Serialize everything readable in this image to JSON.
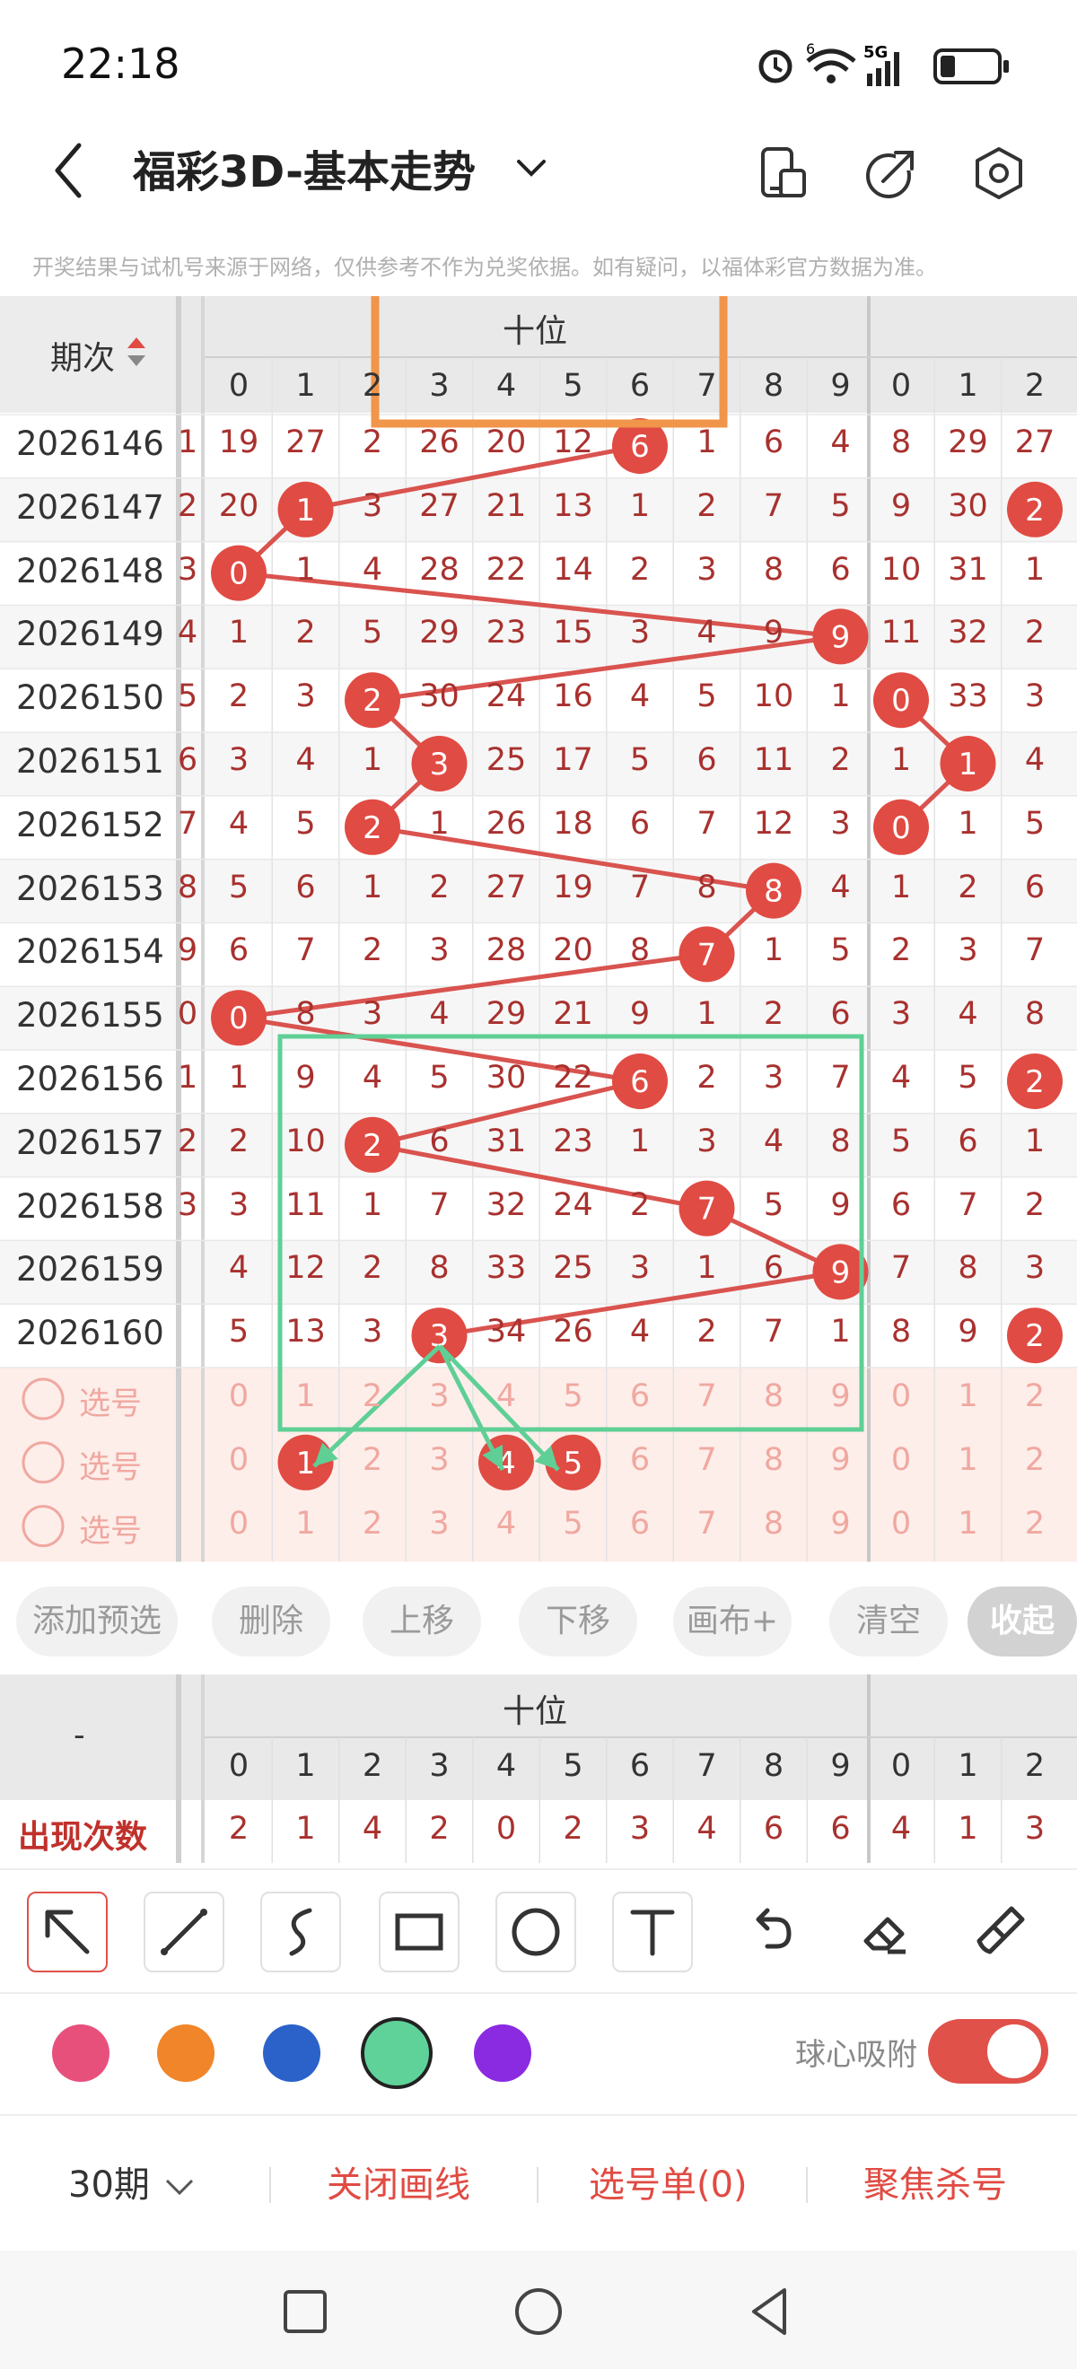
{
  "status_bar": {
    "time": "22:18",
    "network": "5G",
    "wifi_badge": "6"
  },
  "header": {
    "title": "福彩3D-基本走势"
  },
  "notice": "开奖结果与试机号来源于网络，仅供参考不作为兑奖依据。如有疑问，以福体彩官方数据为准。",
  "table": {
    "period_header": "期次",
    "group_title": "十位",
    "digits_main": [
      "0",
      "1",
      "2",
      "3",
      "4",
      "5",
      "6",
      "7",
      "8",
      "9"
    ],
    "digits_next": [
      "0",
      "1",
      "2"
    ],
    "rows": [
      {
        "period": "2026146",
        "edge": "1",
        "cells": [
          "19",
          "27",
          "2",
          "26",
          "20",
          "12",
          "6",
          "1",
          "6",
          "4"
        ],
        "hit": 6,
        "next": [
          "8",
          "29",
          "27"
        ],
        "next_hit": -1
      },
      {
        "period": "2026147",
        "edge": "2",
        "cells": [
          "20",
          "1",
          "3",
          "27",
          "21",
          "13",
          "1",
          "2",
          "7",
          "5"
        ],
        "hit": 1,
        "next": [
          "9",
          "30",
          "2"
        ],
        "next_hit": 2
      },
      {
        "period": "2026148",
        "edge": "3",
        "cells": [
          "0",
          "1",
          "4",
          "28",
          "22",
          "14",
          "2",
          "3",
          "8",
          "6"
        ],
        "hit": 0,
        "next": [
          "10",
          "31",
          "1"
        ],
        "next_hit": -1
      },
      {
        "period": "2026149",
        "edge": "4",
        "cells": [
          "1",
          "2",
          "5",
          "29",
          "23",
          "15",
          "3",
          "4",
          "9",
          "9"
        ],
        "hit": 9,
        "next": [
          "11",
          "32",
          "2"
        ],
        "next_hit": -1
      },
      {
        "period": "2026150",
        "edge": "5",
        "cells": [
          "2",
          "3",
          "2",
          "30",
          "24",
          "16",
          "4",
          "5",
          "10",
          "1"
        ],
        "hit": 2,
        "next": [
          "0",
          "33",
          "3"
        ],
        "next_hit": 0
      },
      {
        "period": "2026151",
        "edge": "6",
        "cells": [
          "3",
          "4",
          "1",
          "3",
          "25",
          "17",
          "5",
          "6",
          "11",
          "2"
        ],
        "hit": 3,
        "next": [
          "1",
          "1",
          "4"
        ],
        "next_hit": 1
      },
      {
        "period": "2026152",
        "edge": "7",
        "cells": [
          "4",
          "5",
          "2",
          "1",
          "26",
          "18",
          "6",
          "7",
          "12",
          "3"
        ],
        "hit": 2,
        "next": [
          "0",
          "1",
          "5"
        ],
        "next_hit": 0
      },
      {
        "period": "2026153",
        "edge": "8",
        "cells": [
          "5",
          "6",
          "1",
          "2",
          "27",
          "19",
          "7",
          "8",
          "8",
          "4"
        ],
        "hit": 8,
        "next": [
          "1",
          "2",
          "6"
        ],
        "next_hit": -1
      },
      {
        "period": "2026154",
        "edge": "9",
        "cells": [
          "6",
          "7",
          "2",
          "3",
          "28",
          "20",
          "8",
          "7",
          "1",
          "5"
        ],
        "hit": 7,
        "next": [
          "2",
          "3",
          "7"
        ],
        "next_hit": -1
      },
      {
        "period": "2026155",
        "edge": "0",
        "cells": [
          "0",
          "8",
          "3",
          "4",
          "29",
          "21",
          "9",
          "1",
          "2",
          "6"
        ],
        "hit": 0,
        "next": [
          "3",
          "4",
          "8"
        ],
        "next_hit": -1
      },
      {
        "period": "2026156",
        "edge": "1",
        "cells": [
          "1",
          "9",
          "4",
          "5",
          "30",
          "22",
          "6",
          "2",
          "3",
          "7"
        ],
        "hit": 6,
        "next": [
          "4",
          "5",
          "2"
        ],
        "next_hit": 2
      },
      {
        "period": "2026157",
        "edge": "2",
        "cells": [
          "2",
          "10",
          "2",
          "6",
          "31",
          "23",
          "1",
          "3",
          "4",
          "8"
        ],
        "hit": 2,
        "next": [
          "5",
          "6",
          "1"
        ],
        "next_hit": -1
      },
      {
        "period": "2026158",
        "edge": "3",
        "cells": [
          "3",
          "11",
          "1",
          "7",
          "32",
          "24",
          "2",
          "7",
          "5",
          "9"
        ],
        "hit": 7,
        "next": [
          "6",
          "7",
          "2"
        ],
        "next_hit": -1
      },
      {
        "period": "2026159",
        "edge": "",
        "cells": [
          "4",
          "12",
          "2",
          "8",
          "33",
          "25",
          "3",
          "1",
          "6",
          "9"
        ],
        "hit": 9,
        "next": [
          "7",
          "8",
          "3"
        ],
        "next_hit": -1
      },
      {
        "period": "2026160",
        "edge": "",
        "cells": [
          "5",
          "13",
          "3",
          "3",
          "34",
          "26",
          "4",
          "2",
          "7",
          "1"
        ],
        "hit": 3,
        "next": [
          "8",
          "9",
          "2"
        ],
        "next_hit": 2
      }
    ],
    "select_rows": [
      {
        "label": "选号",
        "cells": [
          "0",
          "1",
          "2",
          "3",
          "4",
          "5",
          "6",
          "7",
          "8",
          "9"
        ],
        "next": [
          "0",
          "1",
          "2"
        ],
        "picked": []
      },
      {
        "label": "选号",
        "cells": [
          "0",
          "1",
          "2",
          "3",
          "4",
          "5",
          "6",
          "7",
          "8",
          "9"
        ],
        "next": [
          "0",
          "1",
          "2"
        ],
        "picked": [
          1,
          4,
          5
        ]
      },
      {
        "label": "选号",
        "cells": [
          "0",
          "1",
          "2",
          "3",
          "4",
          "5",
          "6",
          "7",
          "8",
          "9"
        ],
        "next": [
          "0",
          "1",
          "2"
        ],
        "picked": []
      }
    ]
  },
  "actions": [
    "添加预选",
    "删除",
    "上移",
    "下移",
    "画布+",
    "清空",
    "收起"
  ],
  "stats": {
    "left_header": "-",
    "group_title": "十位",
    "digits_main": [
      "0",
      "1",
      "2",
      "3",
      "4",
      "5",
      "6",
      "7",
      "8",
      "9"
    ],
    "digits_next": [
      "0",
      "1",
      "2"
    ],
    "label": "出现次数",
    "values": [
      "2",
      "1",
      "4",
      "2",
      "0",
      "2",
      "3",
      "4",
      "6",
      "6"
    ],
    "next_values": [
      "4",
      "1",
      "3"
    ]
  },
  "tools": [
    "select-arrow-icon",
    "line-icon",
    "freehand-icon",
    "rectangle-icon",
    "circle-icon",
    "text-icon",
    "undo-icon",
    "eraser-icon",
    "brush-icon"
  ],
  "palette": {
    "colors": [
      "#e8507c",
      "#f0852a",
      "#2a62c9",
      "#5fd29a",
      "#8a2be2"
    ],
    "selected": 3,
    "magnet_label": "球心吸附",
    "magnet_on": true
  },
  "bottom_bar": {
    "period_select": "30期",
    "close_lines": "关闭画线",
    "selection_list": "选号单(0)",
    "focus_kill": "聚焦杀号"
  },
  "colors": {
    "ball": "#e04b43",
    "trend_line": "#d9534f",
    "highlight_orange": "#f0954a",
    "highlight_green": "#5fcf96"
  }
}
